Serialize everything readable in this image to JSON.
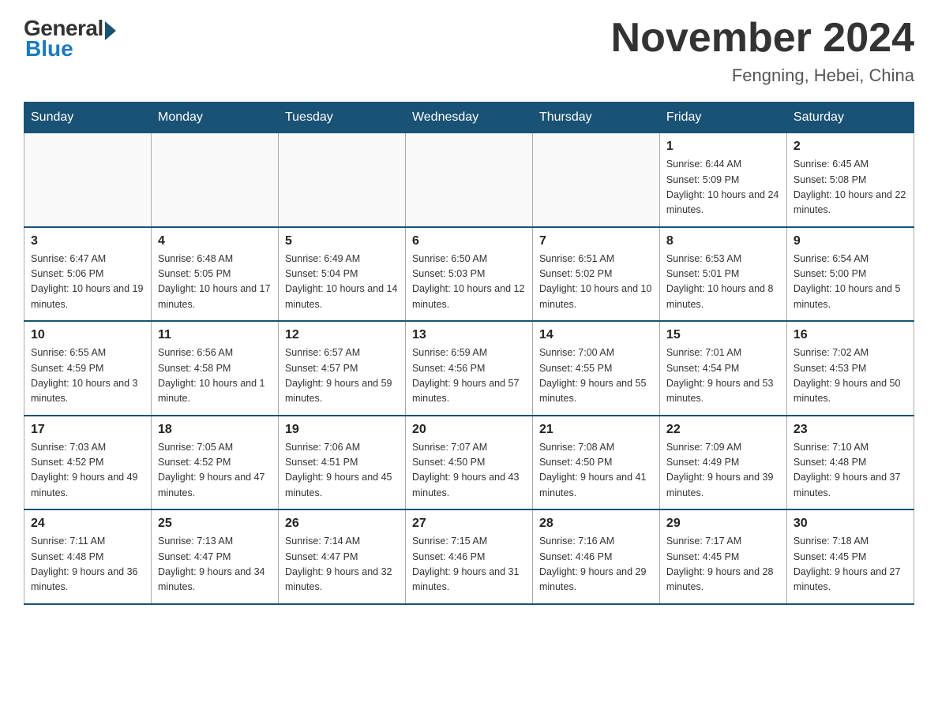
{
  "header": {
    "logo_general": "General",
    "logo_blue": "Blue",
    "title": "November 2024",
    "subtitle": "Fengning, Hebei, China"
  },
  "weekdays": [
    "Sunday",
    "Monday",
    "Tuesday",
    "Wednesday",
    "Thursday",
    "Friday",
    "Saturday"
  ],
  "weeks": [
    [
      {
        "day": "",
        "info": ""
      },
      {
        "day": "",
        "info": ""
      },
      {
        "day": "",
        "info": ""
      },
      {
        "day": "",
        "info": ""
      },
      {
        "day": "",
        "info": ""
      },
      {
        "day": "1",
        "info": "Sunrise: 6:44 AM\nSunset: 5:09 PM\nDaylight: 10 hours and 24 minutes."
      },
      {
        "day": "2",
        "info": "Sunrise: 6:45 AM\nSunset: 5:08 PM\nDaylight: 10 hours and 22 minutes."
      }
    ],
    [
      {
        "day": "3",
        "info": "Sunrise: 6:47 AM\nSunset: 5:06 PM\nDaylight: 10 hours and 19 minutes."
      },
      {
        "day": "4",
        "info": "Sunrise: 6:48 AM\nSunset: 5:05 PM\nDaylight: 10 hours and 17 minutes."
      },
      {
        "day": "5",
        "info": "Sunrise: 6:49 AM\nSunset: 5:04 PM\nDaylight: 10 hours and 14 minutes."
      },
      {
        "day": "6",
        "info": "Sunrise: 6:50 AM\nSunset: 5:03 PM\nDaylight: 10 hours and 12 minutes."
      },
      {
        "day": "7",
        "info": "Sunrise: 6:51 AM\nSunset: 5:02 PM\nDaylight: 10 hours and 10 minutes."
      },
      {
        "day": "8",
        "info": "Sunrise: 6:53 AM\nSunset: 5:01 PM\nDaylight: 10 hours and 8 minutes."
      },
      {
        "day": "9",
        "info": "Sunrise: 6:54 AM\nSunset: 5:00 PM\nDaylight: 10 hours and 5 minutes."
      }
    ],
    [
      {
        "day": "10",
        "info": "Sunrise: 6:55 AM\nSunset: 4:59 PM\nDaylight: 10 hours and 3 minutes."
      },
      {
        "day": "11",
        "info": "Sunrise: 6:56 AM\nSunset: 4:58 PM\nDaylight: 10 hours and 1 minute."
      },
      {
        "day": "12",
        "info": "Sunrise: 6:57 AM\nSunset: 4:57 PM\nDaylight: 9 hours and 59 minutes."
      },
      {
        "day": "13",
        "info": "Sunrise: 6:59 AM\nSunset: 4:56 PM\nDaylight: 9 hours and 57 minutes."
      },
      {
        "day": "14",
        "info": "Sunrise: 7:00 AM\nSunset: 4:55 PM\nDaylight: 9 hours and 55 minutes."
      },
      {
        "day": "15",
        "info": "Sunrise: 7:01 AM\nSunset: 4:54 PM\nDaylight: 9 hours and 53 minutes."
      },
      {
        "day": "16",
        "info": "Sunrise: 7:02 AM\nSunset: 4:53 PM\nDaylight: 9 hours and 50 minutes."
      }
    ],
    [
      {
        "day": "17",
        "info": "Sunrise: 7:03 AM\nSunset: 4:52 PM\nDaylight: 9 hours and 49 minutes."
      },
      {
        "day": "18",
        "info": "Sunrise: 7:05 AM\nSunset: 4:52 PM\nDaylight: 9 hours and 47 minutes."
      },
      {
        "day": "19",
        "info": "Sunrise: 7:06 AM\nSunset: 4:51 PM\nDaylight: 9 hours and 45 minutes."
      },
      {
        "day": "20",
        "info": "Sunrise: 7:07 AM\nSunset: 4:50 PM\nDaylight: 9 hours and 43 minutes."
      },
      {
        "day": "21",
        "info": "Sunrise: 7:08 AM\nSunset: 4:50 PM\nDaylight: 9 hours and 41 minutes."
      },
      {
        "day": "22",
        "info": "Sunrise: 7:09 AM\nSunset: 4:49 PM\nDaylight: 9 hours and 39 minutes."
      },
      {
        "day": "23",
        "info": "Sunrise: 7:10 AM\nSunset: 4:48 PM\nDaylight: 9 hours and 37 minutes."
      }
    ],
    [
      {
        "day": "24",
        "info": "Sunrise: 7:11 AM\nSunset: 4:48 PM\nDaylight: 9 hours and 36 minutes."
      },
      {
        "day": "25",
        "info": "Sunrise: 7:13 AM\nSunset: 4:47 PM\nDaylight: 9 hours and 34 minutes."
      },
      {
        "day": "26",
        "info": "Sunrise: 7:14 AM\nSunset: 4:47 PM\nDaylight: 9 hours and 32 minutes."
      },
      {
        "day": "27",
        "info": "Sunrise: 7:15 AM\nSunset: 4:46 PM\nDaylight: 9 hours and 31 minutes."
      },
      {
        "day": "28",
        "info": "Sunrise: 7:16 AM\nSunset: 4:46 PM\nDaylight: 9 hours and 29 minutes."
      },
      {
        "day": "29",
        "info": "Sunrise: 7:17 AM\nSunset: 4:45 PM\nDaylight: 9 hours and 28 minutes."
      },
      {
        "day": "30",
        "info": "Sunrise: 7:18 AM\nSunset: 4:45 PM\nDaylight: 9 hours and 27 minutes."
      }
    ]
  ]
}
